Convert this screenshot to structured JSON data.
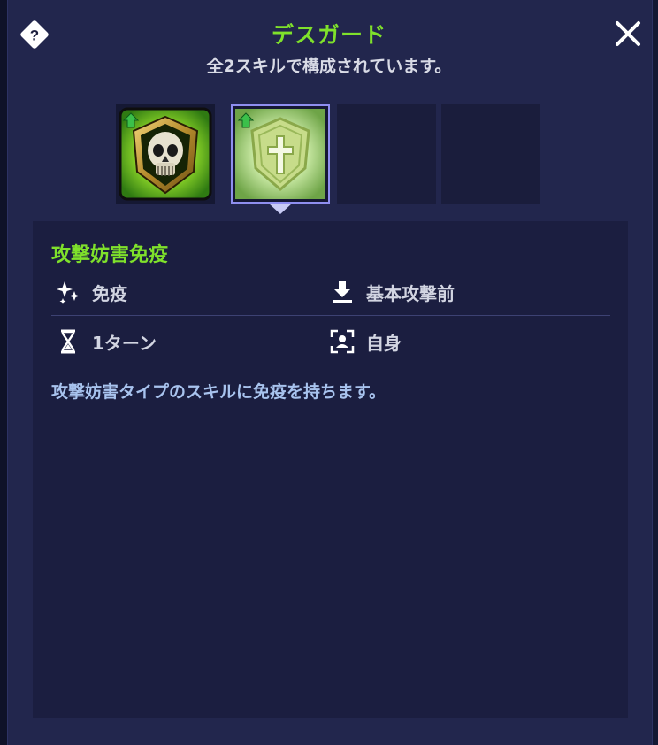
{
  "header": {
    "title": "デスガード",
    "subtitle": "全2スキルで構成されています。"
  },
  "icons": {
    "help": "help-diamond-icon",
    "close": "close-x-icon"
  },
  "skill_slots": [
    {
      "name": "skull-shield-skill",
      "upgradable": true,
      "selected": false
    },
    {
      "name": "cross-shield-skill",
      "upgradable": true,
      "selected": true
    },
    {
      "name": "empty-slot"
    },
    {
      "name": "empty-slot"
    }
  ],
  "skill": {
    "name": "攻撃妨害免疫",
    "attributes": {
      "effect": "免疫",
      "timing": "基本攻撃前",
      "duration": "1ターン",
      "target": "自身"
    },
    "description": "攻撃妨害タイプのスキルに免疫を持ちます。"
  },
  "colors": {
    "accent_green": "#7fe12b",
    "panel_bg": "#22264d",
    "detail_bg": "#1b1e40",
    "description_text": "#a8c3ee"
  }
}
